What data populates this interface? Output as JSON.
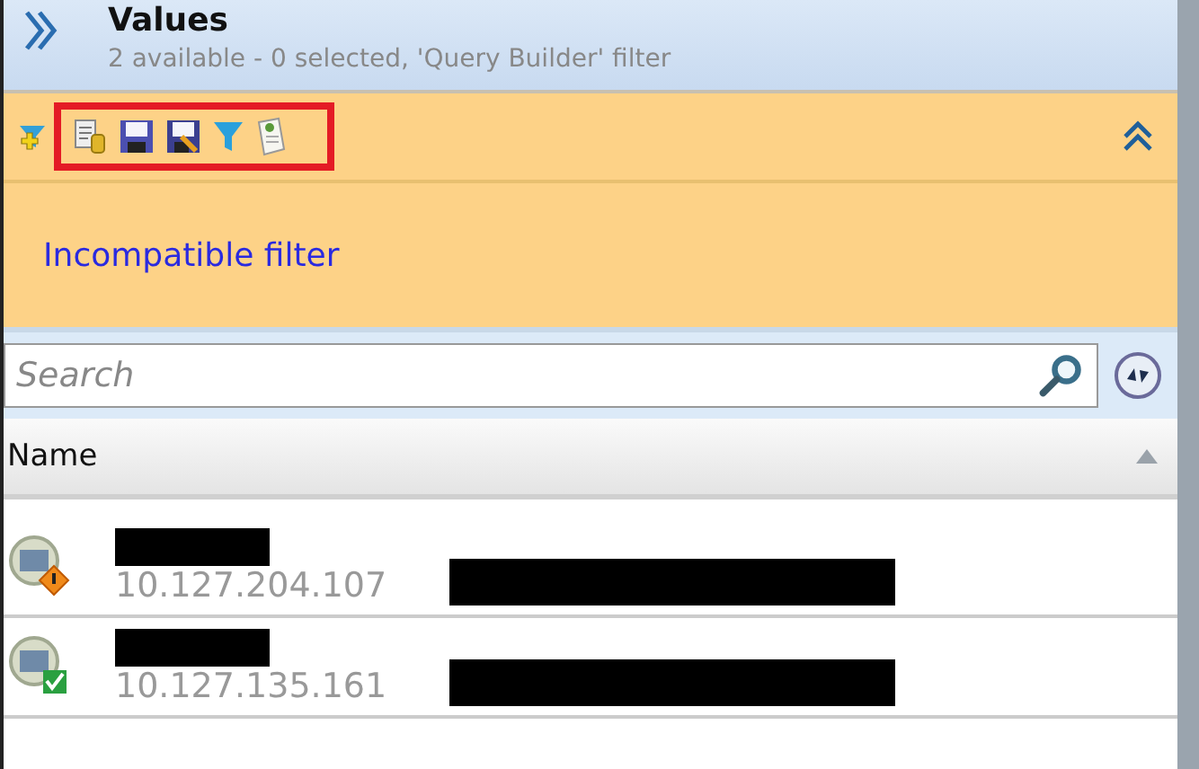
{
  "header": {
    "title": "Values",
    "subtitle": "2 available - 0 selected, 'Query Builder' filter"
  },
  "filter_panel": {
    "message": "Incompatible filter",
    "expanded": true
  },
  "search": {
    "placeholder": "Search"
  },
  "table": {
    "columns": [
      {
        "label": "Name",
        "sort_ascending": true
      }
    ],
    "rows": [
      {
        "kind": "warning",
        "address": "10.127.204.107"
      },
      {
        "kind": "ok",
        "address": "10.127.135.161"
      }
    ]
  }
}
